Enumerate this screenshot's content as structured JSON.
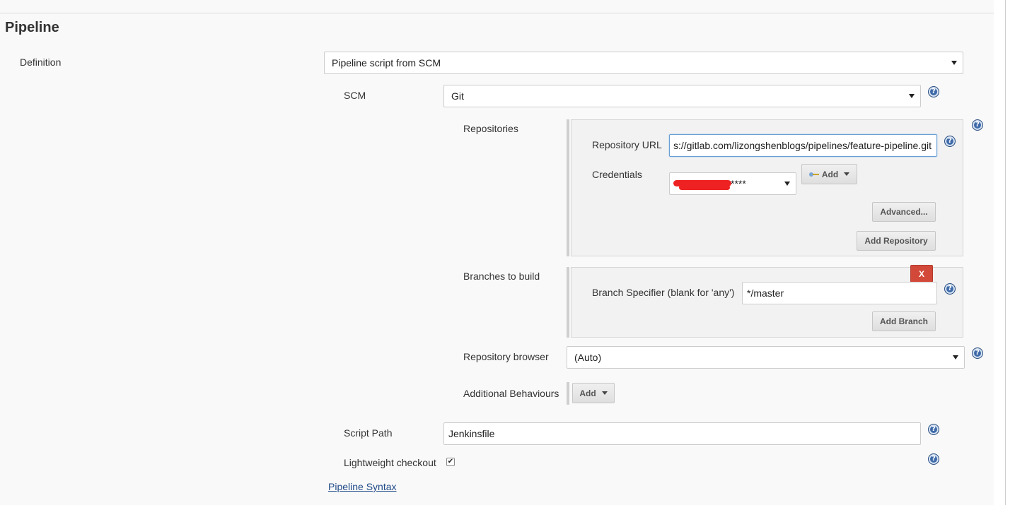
{
  "section": {
    "title": "Pipeline"
  },
  "definition": {
    "label": "Definition",
    "value": "Pipeline script from SCM"
  },
  "scm": {
    "label": "SCM",
    "value": "Git"
  },
  "repositories": {
    "label": "Repositories",
    "url_label": "Repository URL",
    "url_value": "s://gitlab.com/lizongshenblogs/pipelines/feature-pipeline.git",
    "credentials_label": "Credentials",
    "credentials_value": "****",
    "add_label": "Add",
    "advanced_label": "Advanced...",
    "add_repository_label": "Add Repository"
  },
  "branches": {
    "label": "Branches to build",
    "remove_label": "X",
    "specifier_label": "Branch Specifier (blank for 'any')",
    "specifier_value": "*/master",
    "add_branch_label": "Add Branch"
  },
  "repository_browser": {
    "label": "Repository browser",
    "value": "(Auto)"
  },
  "additional_behaviours": {
    "label": "Additional Behaviours",
    "add_label": "Add"
  },
  "script_path": {
    "label": "Script Path",
    "value": "Jenkinsfile"
  },
  "lightweight_checkout": {
    "label": "Lightweight checkout",
    "checked": true,
    "check_glyph": "✔"
  },
  "pipeline_syntax": {
    "label": "Pipeline Syntax"
  },
  "help": {
    "glyph": "?"
  },
  "colors": {
    "help": "#3e6aa8",
    "remove": "#d24939",
    "link": "#204a87"
  }
}
